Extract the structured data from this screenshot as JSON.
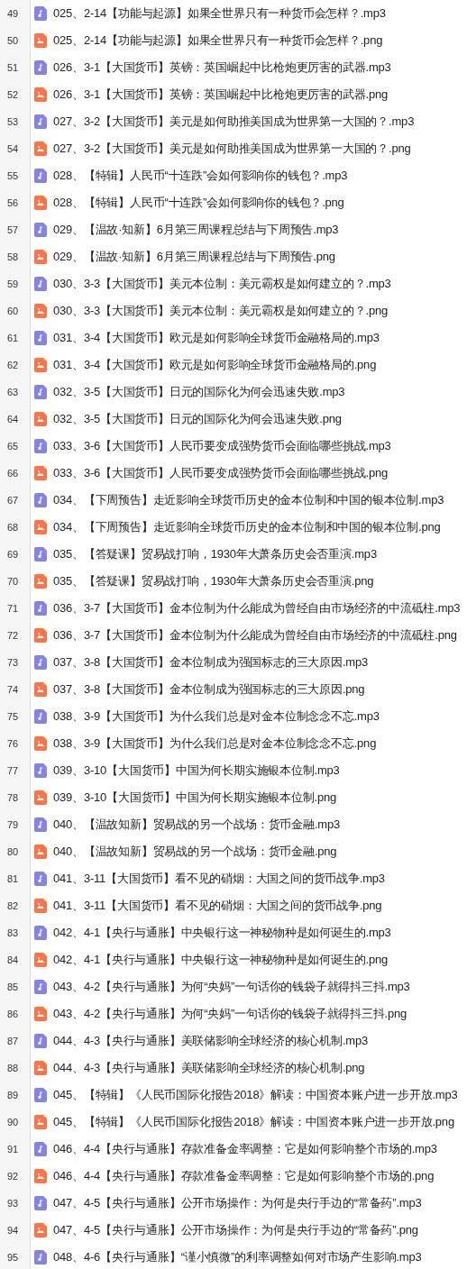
{
  "files": [
    {
      "line": "49",
      "kind": "audio",
      "name": "025、2-14【功能与起源】如果全世界只有一种货币会怎样？.mp3"
    },
    {
      "line": "50",
      "kind": "image",
      "name": "025、2-14【功能与起源】如果全世界只有一种货币会怎样？.png"
    },
    {
      "line": "51",
      "kind": "audio",
      "name": "026、3-1【大国货币】英镑：英国崛起中比枪炮更厉害的武器.mp3"
    },
    {
      "line": "52",
      "kind": "image",
      "name": "026、3-1【大国货币】英镑：英国崛起中比枪炮更厉害的武器.png"
    },
    {
      "line": "53",
      "kind": "audio",
      "name": "027、3-2【大国货币】美元是如何助推美国成为世界第一大国的？.mp3"
    },
    {
      "line": "54",
      "kind": "image",
      "name": "027、3-2【大国货币】美元是如何助推美国成为世界第一大国的？.png"
    },
    {
      "line": "55",
      "kind": "audio",
      "name": "028、【特辑】人民币“十连跌”会如何影响你的钱包？.mp3"
    },
    {
      "line": "56",
      "kind": "image",
      "name": "028、【特辑】人民币“十连跌”会如何影响你的钱包？.png"
    },
    {
      "line": "57",
      "kind": "audio",
      "name": "029、【温故·知新】6月第三周课程总结与下周预告.mp3"
    },
    {
      "line": "58",
      "kind": "image",
      "name": "029、【温故·知新】6月第三周课程总结与下周预告.png"
    },
    {
      "line": "59",
      "kind": "audio",
      "name": "030、3-3【大国货币】美元本位制：美元霸权是如何建立的？.mp3"
    },
    {
      "line": "60",
      "kind": "image",
      "name": "030、3-3【大国货币】美元本位制：美元霸权是如何建立的？.png"
    },
    {
      "line": "61",
      "kind": "audio",
      "name": "031、3-4【大国货币】欧元是如何影响全球货币金融格局的.mp3"
    },
    {
      "line": "62",
      "kind": "image",
      "name": "031、3-4【大国货币】欧元是如何影响全球货币金融格局的.png"
    },
    {
      "line": "63",
      "kind": "audio",
      "name": "032、3-5【大国货币】日元的国际化为何会迅速失败.mp3"
    },
    {
      "line": "64",
      "kind": "image",
      "name": "032、3-5【大国货币】日元的国际化为何会迅速失败.png"
    },
    {
      "line": "65",
      "kind": "audio",
      "name": "033、3-6【大国货币】人民币要变成强势货币会面临哪些挑战.mp3"
    },
    {
      "line": "66",
      "kind": "image",
      "name": "033、3-6【大国货币】人民币要变成强势货币会面临哪些挑战.png"
    },
    {
      "line": "67",
      "kind": "audio",
      "name": "034、【下周预告】走近影响全球货币历史的金本位制和中国的银本位制.mp3"
    },
    {
      "line": "68",
      "kind": "image",
      "name": "034、【下周预告】走近影响全球货币历史的金本位制和中国的银本位制.png"
    },
    {
      "line": "69",
      "kind": "audio",
      "name": "035、【答疑课】贸易战打响，1930年大萧条历史会否重演.mp3"
    },
    {
      "line": "70",
      "kind": "image",
      "name": "035、【答疑课】贸易战打响，1930年大萧条历史会否重演.png"
    },
    {
      "line": "71",
      "kind": "audio",
      "name": "036、3-7【大国货币】金本位制为什么能成为曾经自由市场经济的中流砥柱.mp3"
    },
    {
      "line": "72",
      "kind": "image",
      "name": "036、3-7【大国货币】金本位制为什么能成为曾经自由市场经济的中流砥柱.png"
    },
    {
      "line": "73",
      "kind": "audio",
      "name": "037、3-8【大国货币】金本位制成为强国标志的三大原因.mp3"
    },
    {
      "line": "74",
      "kind": "image",
      "name": "037、3-8【大国货币】金本位制成为强国标志的三大原因.png"
    },
    {
      "line": "75",
      "kind": "audio",
      "name": "038、3-9【大国货币】为什么我们总是对金本位制念念不忘.mp3"
    },
    {
      "line": "76",
      "kind": "image",
      "name": "038、3-9【大国货币】为什么我们总是对金本位制念念不忘.png"
    },
    {
      "line": "77",
      "kind": "audio",
      "name": "039、3-10【大国货币】中国为何长期实施银本位制.mp3"
    },
    {
      "line": "78",
      "kind": "image",
      "name": "039、3-10【大国货币】中国为何长期实施银本位制.png"
    },
    {
      "line": "79",
      "kind": "audio",
      "name": "040、【温故知新】贸易战的另一个战场：货币金融.mp3"
    },
    {
      "line": "80",
      "kind": "image",
      "name": "040、【温故知新】贸易战的另一个战场：货币金融.png"
    },
    {
      "line": "81",
      "kind": "audio",
      "name": "041、3-11【大国货币】看不见的硝烟：大国之间的货币战争.mp3"
    },
    {
      "line": "82",
      "kind": "image",
      "name": "041、3-11【大国货币】看不见的硝烟：大国之间的货币战争.png"
    },
    {
      "line": "83",
      "kind": "audio",
      "name": "042、4-1【央行与通胀】中央银行这一神秘物种是如何诞生的.mp3"
    },
    {
      "line": "84",
      "kind": "image",
      "name": "042、4-1【央行与通胀】中央银行这一神秘物种是如何诞生的.png"
    },
    {
      "line": "85",
      "kind": "audio",
      "name": "043、4-2【央行与通胀】为何“央妈”一句话你的钱袋子就得抖三抖.mp3"
    },
    {
      "line": "86",
      "kind": "image",
      "name": "043、4-2【央行与通胀】为何“央妈”一句话你的钱袋子就得抖三抖.png"
    },
    {
      "line": "87",
      "kind": "audio",
      "name": "044、4-3【央行与通胀】美联储影响全球经济的核心机制.mp3"
    },
    {
      "line": "88",
      "kind": "image",
      "name": "044、4-3【央行与通胀】美联储影响全球经济的核心机制.png"
    },
    {
      "line": "89",
      "kind": "audio",
      "name": "045、【特辑】《人民币国际化报告2018》解读：中国资本账户进一步开放.mp3"
    },
    {
      "line": "90",
      "kind": "image",
      "name": "045、【特辑】《人民币国际化报告2018》解读：中国资本账户进一步开放.png"
    },
    {
      "line": "91",
      "kind": "audio",
      "name": "046、4-4【央行与通胀】存款准备金率调整：它是如何影响整个市场的.mp3"
    },
    {
      "line": "92",
      "kind": "image",
      "name": "046、4-4【央行与通胀】存款准备金率调整：它是如何影响整个市场的.png"
    },
    {
      "line": "93",
      "kind": "audio",
      "name": "047、4-5【央行与通胀】公开市场操作：为何是央行手边的“常备药”.mp3"
    },
    {
      "line": "94",
      "kind": "image",
      "name": "047、4-5【央行与通胀】公开市场操作：为何是央行手边的“常备药”.png"
    },
    {
      "line": "95",
      "kind": "audio",
      "name": "048、4-6【央行与通胀】“谨小慎微”的利率调整如何对市场产生影响.mp3"
    }
  ]
}
